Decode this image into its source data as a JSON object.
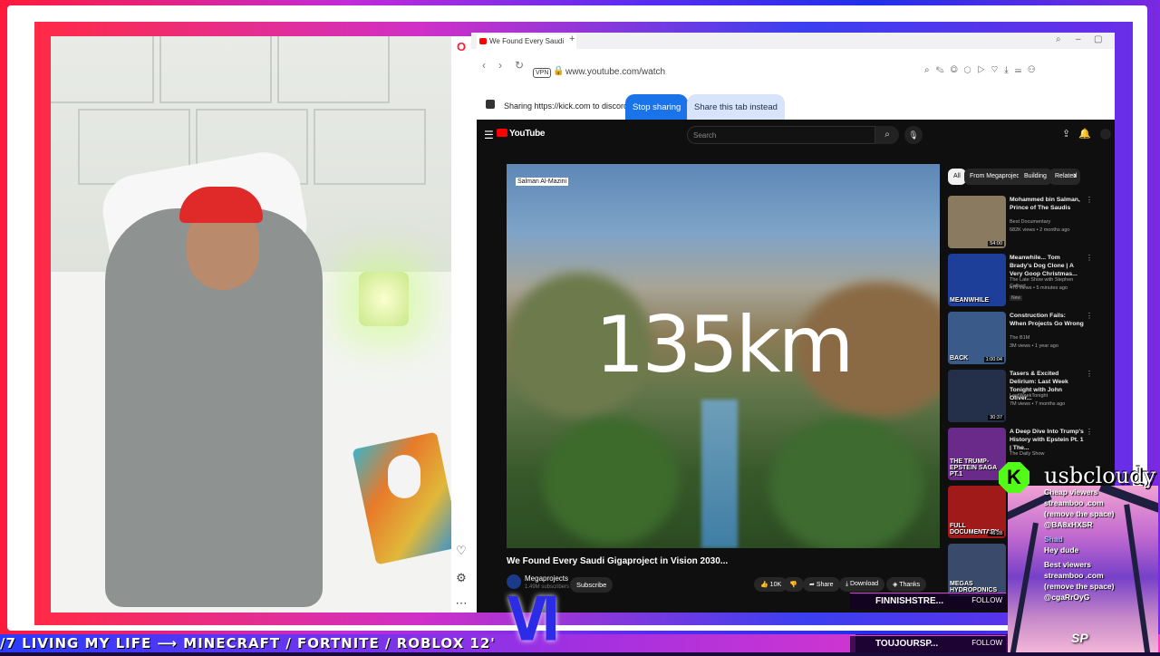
{
  "browser": {
    "tab_title": "We Found Every Saudi",
    "url": "www.youtube.com/watch",
    "vpn_label": "VPN",
    "share_text": "Sharing https://kick.com to discord.com",
    "stop_sharing": "Stop sharing",
    "share_this_tab": "Share this tab instead"
  },
  "youtube": {
    "logo": "YouTube",
    "search_placeholder": "Search",
    "overlay_tag": "Salman Al-Mazini",
    "overlay_text": "135km",
    "video_title": "We Found Every Saudi Gigaproject in Vision 2030...",
    "channel_name": "Megaprojects",
    "channel_subs": "1.49M subscribers",
    "subscribe": "Subscribe",
    "likes": "10K",
    "share": "Share",
    "download": "Download",
    "thanks": "Thanks",
    "chips": [
      "All",
      "From Megaprojects",
      "Building",
      "Related"
    ],
    "recommendations": [
      {
        "title": "Mohammed bin Salman, Prince of The Saudis",
        "channel": "Best Documentary",
        "stats": "682K views • 2 months ago",
        "duration": "54:00",
        "thumb_color": "#8a7a60"
      },
      {
        "title": "Meanwhile... Tom Brady's Dog Clone | A Very Goop Christmas...",
        "channel": "The Late Show with Stephen Colbert",
        "stats": "470 views • 5 minutes ago",
        "duration": "",
        "badge": "New",
        "thumb_text": "MEANWHILE",
        "thumb_color": "#1d3f9a"
      },
      {
        "title": "Construction Fails: When Projects Go Wrong",
        "channel": "The B1M",
        "stats": "3M views • 1 year ago",
        "duration": "1:00:04",
        "thumb_text": "BACK",
        "thumb_color": "#3a5a8a"
      },
      {
        "title": "Tasers & Excited Delirium: Last Week Tonight with John Oliver...",
        "channel": "LastWeekTonight",
        "stats": "7M views • 7 months ago",
        "duration": "30:37",
        "thumb_color": "#24304a"
      },
      {
        "title": "A Deep Dive Into Trump's History with Epstein Pt. 1 | The...",
        "channel": "The Daily Show",
        "stats": "",
        "duration": "",
        "thumb_text": "THE TRUMP-EPSTEIN SAGA PT.1",
        "thumb_color": "#6a2a8a"
      },
      {
        "title": "",
        "channel": "",
        "stats": "",
        "duration": "46:28",
        "thumb_text": "FULL DOCUMENTARY",
        "thumb_color": "#a01a1a"
      },
      {
        "title": "",
        "channel": "",
        "stats": "",
        "duration": "",
        "thumb_text": "MEGAS HYDROPONICS",
        "thumb_color": "#3a4a6a"
      }
    ]
  },
  "stream": {
    "kick_username": "usbcloudy",
    "chat": [
      {
        "text": "Cheap viewers",
        "dim": false
      },
      {
        "text": "streamboo .com",
        "dim": false
      },
      {
        "text": "(remove the space)",
        "dim": false
      },
      {
        "text": "@BA8xHXSR",
        "dim": false
      },
      {
        "text": "Shad",
        "dim": true
      },
      {
        "text": "Hey dude",
        "dim": false
      },
      {
        "text": "Best viewers",
        "dim": false
      },
      {
        "text": "streamboo .com",
        "dim": false
      },
      {
        "text": "(remove the space)",
        "dim": false
      },
      {
        "text": "@cgaRrOyG",
        "dim": false
      }
    ],
    "sp_label": "SP",
    "follow_1": {
      "name": "FINNISHSTRE...",
      "btn": "FOLLOW"
    },
    "follow_2": {
      "name": "TOUJOURSP...",
      "btn": "FOLLOW"
    },
    "ticker": "/7 LIVING MY LIFE ⟶ MINECRAFT / FORTNITE / ROBLOX 12'",
    "logo_text": "VI"
  }
}
